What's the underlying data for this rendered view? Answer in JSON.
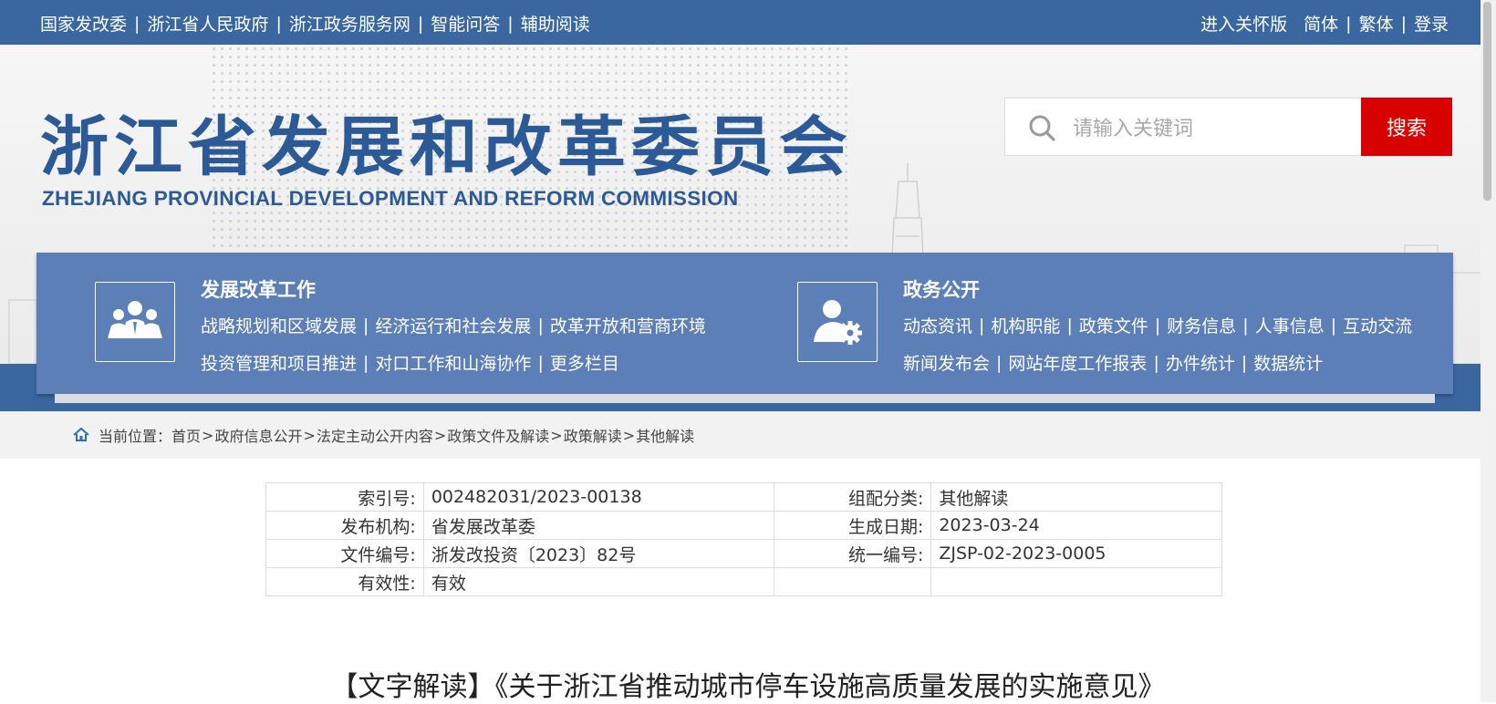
{
  "topbar": {
    "left_links": [
      "国家发改委",
      "浙江省人民政府",
      "浙江政务服务网",
      "智能问答",
      "辅助阅读"
    ],
    "right_links": [
      "进入关怀版",
      "简体",
      "繁体",
      "登录"
    ]
  },
  "header": {
    "title_cn": "浙江省发展和改革委员会",
    "title_en": "ZHEJIANG PROVINCIAL DEVELOPMENT AND REFORM COMMISSION"
  },
  "search": {
    "placeholder": "请输入关键词",
    "button_label": "搜索"
  },
  "nav": {
    "groups": [
      {
        "title": "发展改革工作",
        "icon": "people-group-icon",
        "rows": [
          [
            "战略规划和区域发展",
            "经济运行和社会发展",
            "改革开放和营商环境"
          ],
          [
            "投资管理和项目推进",
            "对口工作和山海协作",
            "更多栏目"
          ]
        ]
      },
      {
        "title": "政务公开",
        "icon": "user-gear-icon",
        "rows": [
          [
            "动态资讯",
            "机构职能",
            "政策文件",
            "财务信息",
            "人事信息",
            "互动交流"
          ],
          [
            "新闻发布会",
            "网站年度工作报表",
            "办件统计",
            "数据统计"
          ]
        ]
      }
    ]
  },
  "breadcrumb": {
    "prefix": "当前位置：",
    "items": [
      "首页",
      "政府信息公开",
      "法定主动公开内容",
      "政策文件及解读",
      "政策解读",
      "其他解读"
    ]
  },
  "info": {
    "rows": [
      {
        "l1": "索引号:",
        "v1": "002482031/2023-00138",
        "l2": "组配分类:",
        "v2": "其他解读"
      },
      {
        "l1": "发布机构:",
        "v1": "省发展改革委",
        "l2": "生成日期:",
        "v2": "2023-03-24"
      },
      {
        "l1": "文件编号:",
        "v1": "浙发改投资〔2023〕82号",
        "l2": "统一编号:",
        "v2": "ZJSP-02-2023-0005"
      },
      {
        "l1": "有效性:",
        "v1": "有效",
        "l2": "",
        "v2": ""
      }
    ]
  },
  "article": {
    "title": "【文字解读】《关于浙江省推动城市停车设施高质量发展的实施意见》"
  },
  "colors": {
    "topbar": "#3a67a0",
    "nav_panel": "#5b7fb6",
    "brand_text": "#2c5a97",
    "search_button": "#d90000"
  }
}
